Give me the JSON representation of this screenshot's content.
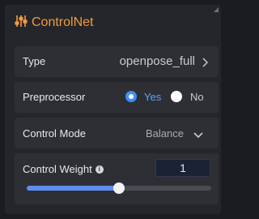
{
  "panel": {
    "title": "ControlNet",
    "title_icon": "sliders-icon",
    "accent_color": "#f39a3c",
    "fields": {
      "type": {
        "label": "Type",
        "value": "openpose_full"
      },
      "preprocessor": {
        "label": "Preprocessor",
        "options": [
          "Yes",
          "No"
        ],
        "selected": "Yes"
      },
      "control_mode": {
        "label": "Control Mode",
        "value": "Balance"
      },
      "control_weight": {
        "label": "Control Weight",
        "value": "1",
        "slider_fraction": 0.5
      }
    }
  }
}
